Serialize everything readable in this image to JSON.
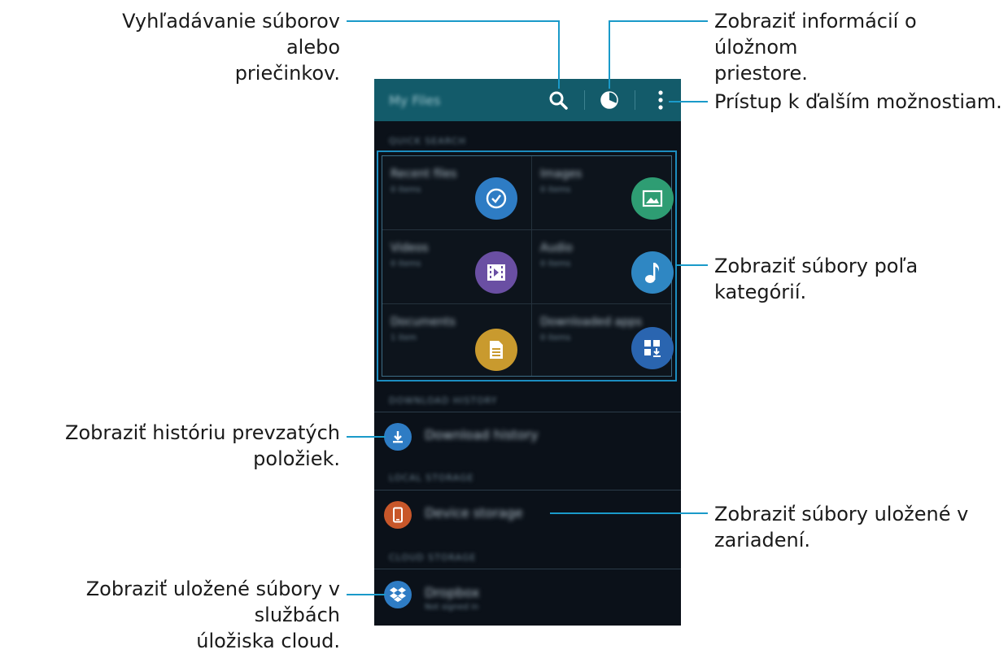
{
  "callouts": {
    "search": [
      "Vyhľadávanie súborov alebo",
      "priečinkov."
    ],
    "storage_info": [
      "Zobraziť informácií o úložnom",
      "priestore."
    ],
    "more_options": [
      "Prístup k ďalším možnostiam."
    ],
    "categories": [
      "Zobraziť súbory poľa kategórií."
    ],
    "download_history": [
      "Zobraziť históriu prevzatých",
      "položiek."
    ],
    "device_storage": [
      "Zobraziť súbory uložené v",
      "zariadení."
    ],
    "cloud": [
      "Zobraziť uložené súbory v službách",
      "úložiska cloud."
    ]
  },
  "app": {
    "title": "My Files",
    "icons": [
      "search-icon",
      "storage-usage-icon",
      "more-options-icon"
    ],
    "sections": {
      "quick_search": "QUICK SEARCH",
      "download_history": "DOWNLOAD HISTORY",
      "local_storage": "LOCAL STORAGE",
      "cloud_storage": "CLOUD STORAGE"
    },
    "categories": [
      {
        "label": "Recent files",
        "sub": "0 items",
        "icon": "clock-icon",
        "color": "#2e7cc4"
      },
      {
        "label": "Images",
        "sub": "0 items",
        "icon": "image-icon",
        "color": "#2e9d73"
      },
      {
        "label": "Videos",
        "sub": "0 items",
        "icon": "film-icon",
        "color": "#6a4fa3"
      },
      {
        "label": "Audio",
        "sub": "0 items",
        "icon": "music-note-icon",
        "color": "#2f87c3"
      },
      {
        "label": "Documents",
        "sub": "1 item",
        "icon": "document-icon",
        "color": "#c99a2e"
      },
      {
        "label": "Downloaded apps",
        "sub": "0 items",
        "icon": "download-apps-icon",
        "color": "#2a65b0"
      }
    ],
    "rows": {
      "download_history": {
        "label": "Download history",
        "icon": "download-icon",
        "color": "#2e7cc4"
      },
      "device_storage": {
        "label": "Device storage",
        "icon": "phone-icon",
        "color": "#c8572a"
      },
      "dropbox": {
        "label": "Dropbox",
        "sub": "Not signed in",
        "icon": "dropbox-icon",
        "color": "#2e7cc4"
      }
    }
  },
  "colors": {
    "accent_line": "#1a9ac9",
    "action_bar": "#135b6a",
    "screen_bg": "#0b1119"
  }
}
